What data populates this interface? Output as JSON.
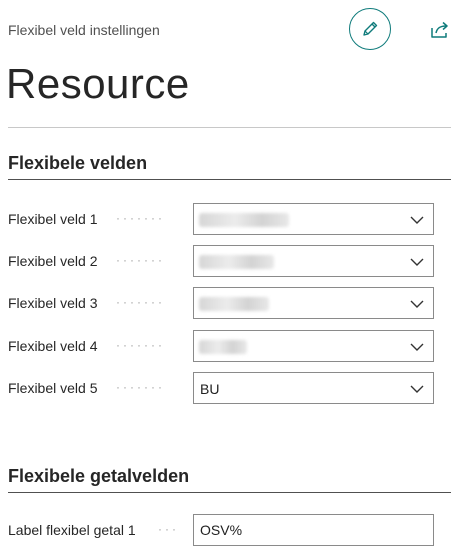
{
  "header": {
    "breadcrumb": "Flexibel veld instellingen",
    "title": "Resource",
    "edit_icon": "pencil-icon",
    "share_icon": "share-icon"
  },
  "sections": [
    {
      "title": "Flexibele velden",
      "fields": [
        {
          "label": "Flexibel veld 1",
          "value": "",
          "blurred": true
        },
        {
          "label": "Flexibel veld 2",
          "value": "",
          "blurred": true
        },
        {
          "label": "Flexibel veld 3",
          "value": "",
          "blurred": true
        },
        {
          "label": "Flexibel veld 4",
          "value": "",
          "blurred": true
        },
        {
          "label": "Flexibel veld 5",
          "value": "BU",
          "blurred": false
        }
      ]
    },
    {
      "title": "Flexibele getalvelden",
      "fields": [
        {
          "label": "Label flexibel getal 1",
          "value": "OSV%"
        }
      ]
    }
  ],
  "colors": {
    "accent": "#0f7b7b",
    "border": "#8a8a8a",
    "text": "#212121"
  }
}
